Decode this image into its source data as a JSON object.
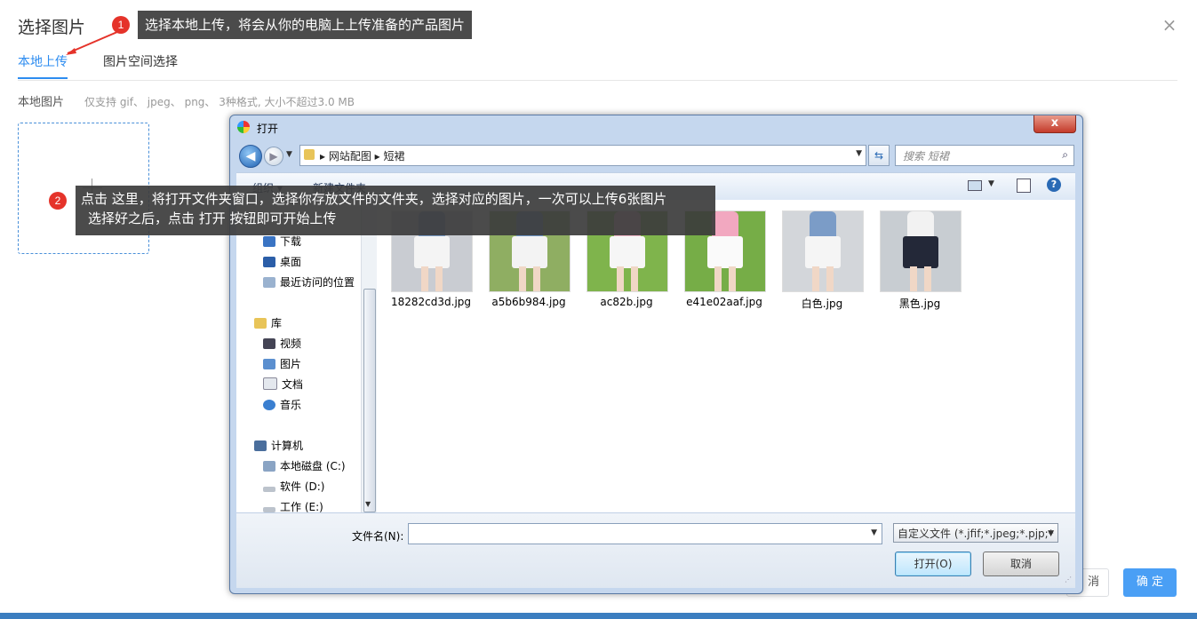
{
  "dialog": {
    "title": "选择图片",
    "close_glyph": "×",
    "tabs": [
      {
        "label": "本地上传",
        "active": true
      },
      {
        "label": "图片空间选择",
        "active": false
      }
    ],
    "local_label": "本地图片",
    "hint": "仅支持 gif、 jpeg、 png、 3种格式, 大小不超过3.0 MB",
    "plus_icon": "plus-icon",
    "cancel_label": "消",
    "ok_label": "确 定",
    "accent_color": "#2d8cf0"
  },
  "callouts": [
    {
      "badge": "1",
      "text": "选择本地上传，将会从你的电脑上上传准备的产品图片"
    },
    {
      "badge": "2",
      "line1": "点击 这里，将打开文件夹窗口，选择你存放文件的文件夹，选择对应的图片，一次可以上传6张图片",
      "line2": "选择好之后，点击 打开 按钮即可开始上传"
    }
  ],
  "file_dialog": {
    "title": "打开",
    "close_glyph": "x",
    "back_glyph": "◀",
    "fwd_glyph": "▶",
    "breadcrumb": "▸ 网站配图 ▸ 短裙",
    "search_placeholder": "搜索 短裙",
    "toolbar": {
      "organize": "组织 ▾",
      "new_folder": "新建文件夹",
      "help": "?"
    },
    "nav": {
      "favorites": [
        {
          "label": "下载",
          "icon": "download-folder-icon"
        },
        {
          "label": "桌面",
          "icon": "desktop-icon"
        },
        {
          "label": "最近访问的位置",
          "icon": "recent-places-icon"
        }
      ],
      "libraries_label": "库",
      "libraries": [
        {
          "label": "视频",
          "icon": "video-library-icon"
        },
        {
          "label": "图片",
          "icon": "pictures-library-icon"
        },
        {
          "label": "文档",
          "icon": "documents-library-icon"
        },
        {
          "label": "音乐",
          "icon": "music-library-icon"
        }
      ],
      "computer_label": "计算机",
      "drives": [
        {
          "label": "本地磁盘 (C:)",
          "icon": "local-disk-icon"
        },
        {
          "label": "软件 (D:)",
          "icon": "drive-icon"
        },
        {
          "label": "工作 (E:)",
          "icon": "drive-icon"
        }
      ]
    },
    "files": [
      {
        "name": "18282cd3d.jpg",
        "shirt": "#7a9cc6",
        "skirt": "#f4f4f4",
        "bg": "#c9ccd2"
      },
      {
        "name": "a5b6b984.jpg",
        "shirt": "#6e95c4",
        "skirt": "#f3f3f3",
        "bg": "#8fae62"
      },
      {
        "name": "ac82b.jpg",
        "shirt": "#f0b6c8",
        "skirt": "#f6f6f6",
        "bg": "#7fb44c"
      },
      {
        "name": "e41e02aaf.jpg",
        "shirt": "#f2a8c0",
        "skirt": "#fafafa",
        "bg": "#76ad47"
      },
      {
        "name": "白色.jpg",
        "shirt": "#7b9cc7",
        "skirt": "#f5f5f5",
        "bg": "#d3d6da"
      },
      {
        "name": "黑色.jpg",
        "shirt": "#f2f2f2",
        "skirt": "#232838",
        "bg": "#c8cdd2"
      }
    ],
    "filename_label": "文件名(N):",
    "filename_value": "",
    "filter_value": "自定义文件 (*.jfif;*.jpeg;*.pjp;*",
    "open_label": "打开(O)",
    "cancel_label": "取消"
  }
}
